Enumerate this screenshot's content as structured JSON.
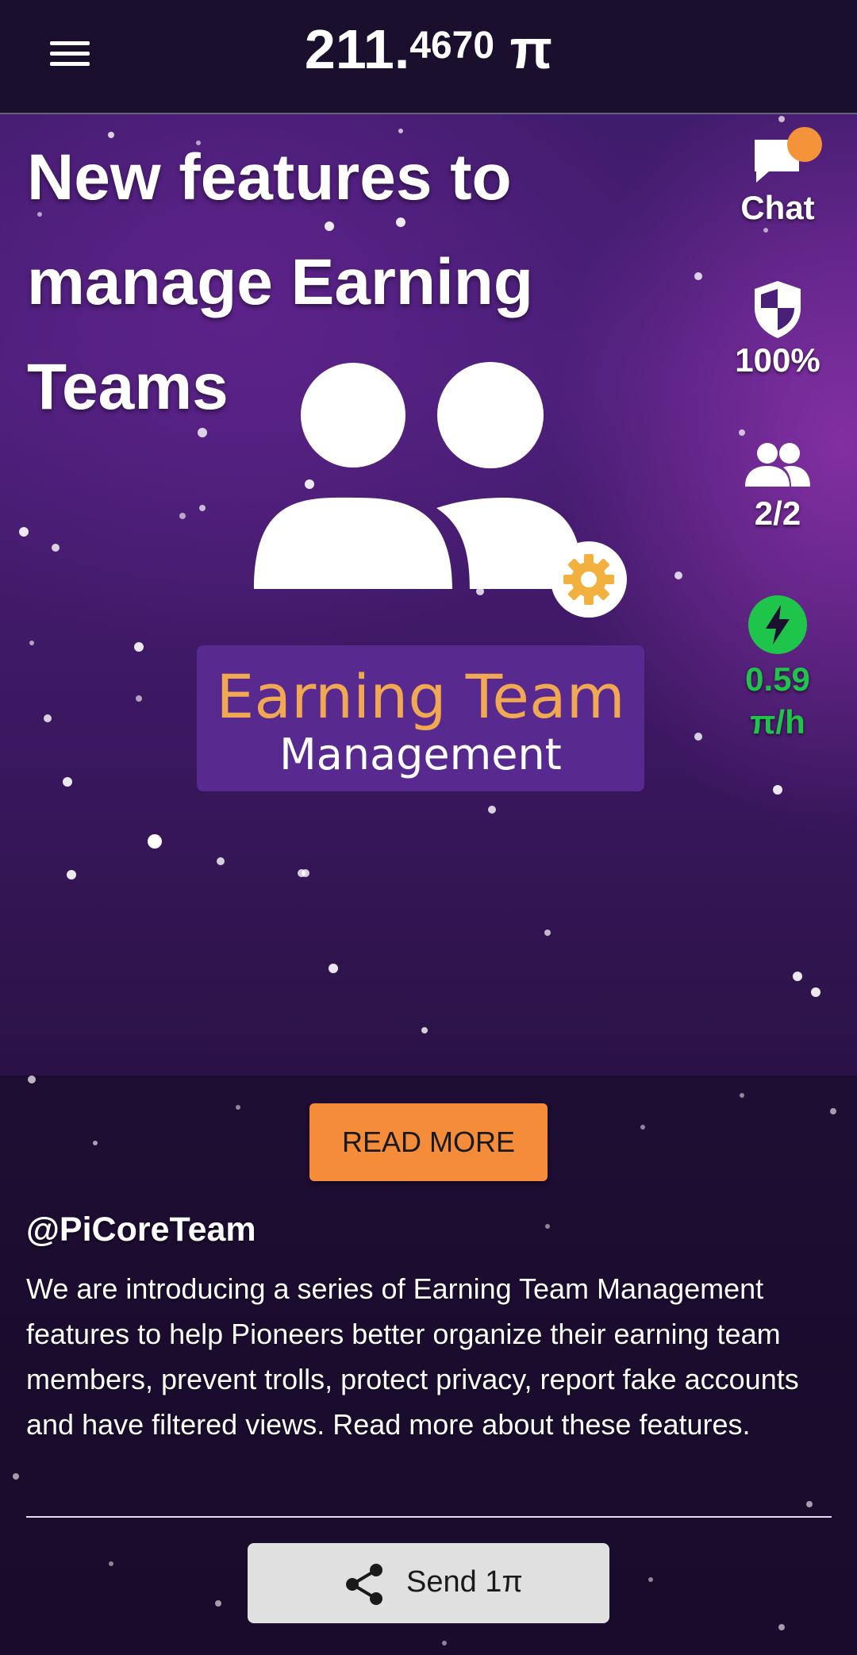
{
  "header": {
    "balance_int": "211.",
    "balance_dec": "4670",
    "balance_unit": " π"
  },
  "news": {
    "headline": "New features to manage Earning Teams",
    "banner_line1": "Earning Team",
    "banner_line2": "Management",
    "read_more_label": "READ MORE",
    "author": "@PiCoreTeam",
    "body": "We are introducing a series of Earning Team Management features to help Pioneers better organize their earning team members, prevent trolls, protect privacy, report fake accounts and have filtered views. Read more about these features."
  },
  "sidebar": {
    "chat_label": "Chat",
    "security_value": "100%",
    "team_value": "2/2",
    "rate_value": "0.59",
    "rate_unit": "π/h"
  },
  "footer": {
    "send_label": "Send 1π"
  },
  "colors": {
    "accent_orange": "#f48c3a",
    "rate_green": "#1fc54a",
    "banner_purple": "#58298f",
    "banner_text_orange": "#f0a852"
  },
  "icons": [
    "menu-icon",
    "chat-icon",
    "shield-icon",
    "team-icon",
    "lightning-icon",
    "gear-icon",
    "share-icon"
  ]
}
